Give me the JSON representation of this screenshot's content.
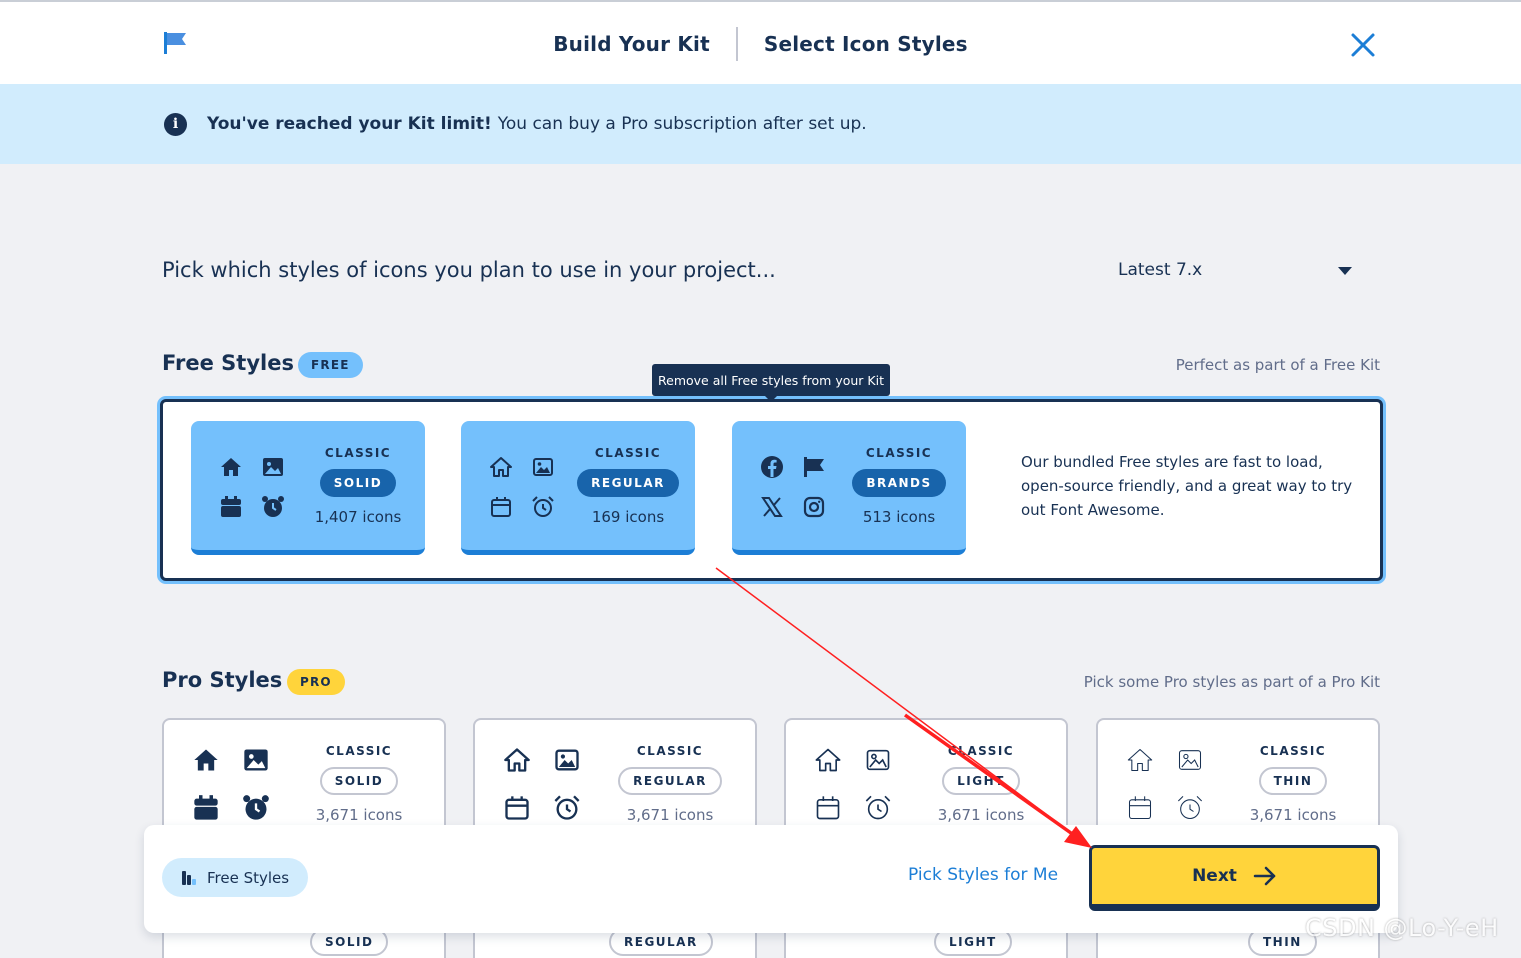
{
  "header": {
    "breadcrumbs": [
      "Build Your Kit",
      "Select Icon Styles"
    ]
  },
  "banner": {
    "strong": "You've reached your Kit limit!",
    "rest": "You can buy a Pro subscription after set up."
  },
  "intro": "Pick which styles of icons you plan to use in your project...",
  "version": {
    "selected": "Latest 7.x"
  },
  "free": {
    "title": "Free Styles",
    "badge": "FREE",
    "note": "Perfect as part of a Free Kit",
    "tooltip": "Remove all Free styles from your Kit",
    "description": "Our bundled Free styles are fast to load, open-source friendly, and a great way to try out Font Awesome.",
    "cards": [
      {
        "family": "CLASSIC",
        "style": "SOLID",
        "count": "1,407 icons"
      },
      {
        "family": "CLASSIC",
        "style": "REGULAR",
        "count": "169 icons"
      },
      {
        "family": "CLASSIC",
        "style": "BRANDS",
        "count": "513 icons"
      }
    ]
  },
  "pro": {
    "title": "Pro Styles",
    "badge": "PRO",
    "note": "Pick some Pro styles as part of a Pro Kit",
    "cards": [
      {
        "family": "CLASSIC",
        "style": "SOLID",
        "count": "3,671 icons"
      },
      {
        "family": "CLASSIC",
        "style": "REGULAR",
        "count": "3,671 icons"
      },
      {
        "family": "CLASSIC",
        "style": "LIGHT",
        "count": "3,671 icons"
      },
      {
        "family": "CLASSIC",
        "style": "THIN",
        "count": "3,671 icons"
      }
    ],
    "lower_row": [
      "SOLID",
      "REGULAR",
      "LIGHT",
      "THIN"
    ]
  },
  "footer": {
    "free_styles_label": "Free Styles",
    "pick_link": "Pick Styles for Me",
    "next_label": "Next"
  },
  "watermark": "CSDN @Lo-Y-eH",
  "colors": {
    "navy": "#183153",
    "sky": "#74c0fc",
    "banner": "#d1ecfd",
    "yellow": "#ffd43b",
    "link": "#1c7ed6",
    "annotation_arrow": "#ff0000"
  }
}
